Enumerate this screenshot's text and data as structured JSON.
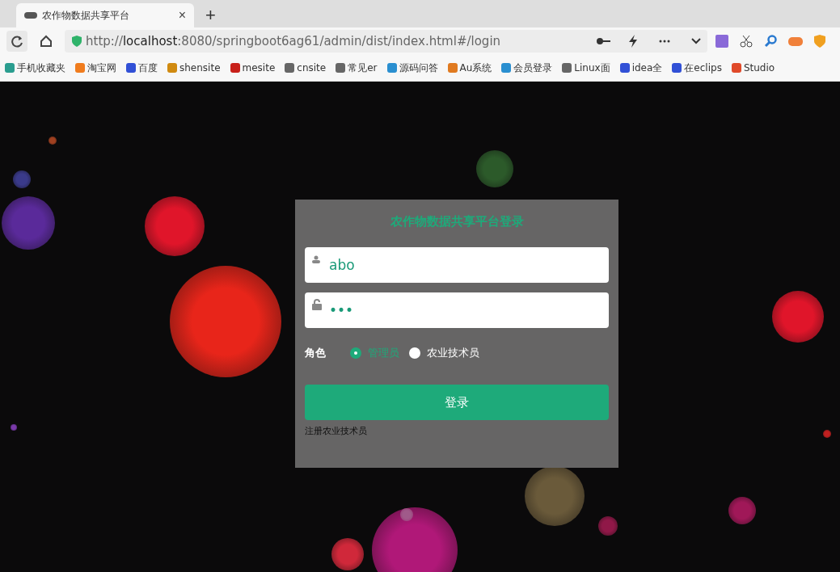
{
  "browser": {
    "tab": {
      "title": "农作物数据共享平台",
      "close": "×"
    },
    "new_tab": "+",
    "address": {
      "scheme": "http://",
      "host": "localhost",
      "rest": ":8080/springboot6ag61/admin/dist/index.html#/login"
    },
    "bookmarks": [
      {
        "label": "手机收藏夹",
        "color": "#2a9d8f"
      },
      {
        "label": "淘宝网",
        "color": "#f07c1e"
      },
      {
        "label": "百度",
        "color": "#3150d6"
      },
      {
        "label": "shensite",
        "color": "#d08a10"
      },
      {
        "label": "mesite",
        "color": "#c8201a"
      },
      {
        "label": "cnsite",
        "color": "#666666"
      },
      {
        "label": "常见er",
        "color": "#666666"
      },
      {
        "label": "源码问答",
        "color": "#2a8fd0"
      },
      {
        "label": "Au系统",
        "color": "#e07a20"
      },
      {
        "label": "会员登录",
        "color": "#2a8fd0"
      },
      {
        "label": "Linux面",
        "color": "#666666"
      },
      {
        "label": "idea全",
        "color": "#3150d6"
      },
      {
        "label": "在eclips",
        "color": "#3150d6"
      },
      {
        "label": "Studio",
        "color": "#e04a2a"
      }
    ]
  },
  "login": {
    "title": "农作物数据共享平台登录",
    "username": "abo",
    "password": "•••",
    "role_label": "角色",
    "roles": [
      {
        "label": "管理员",
        "selected": true
      },
      {
        "label": "农业技术员",
        "selected": false
      }
    ],
    "submit": "登录",
    "register_link": "注册农业技术员"
  }
}
